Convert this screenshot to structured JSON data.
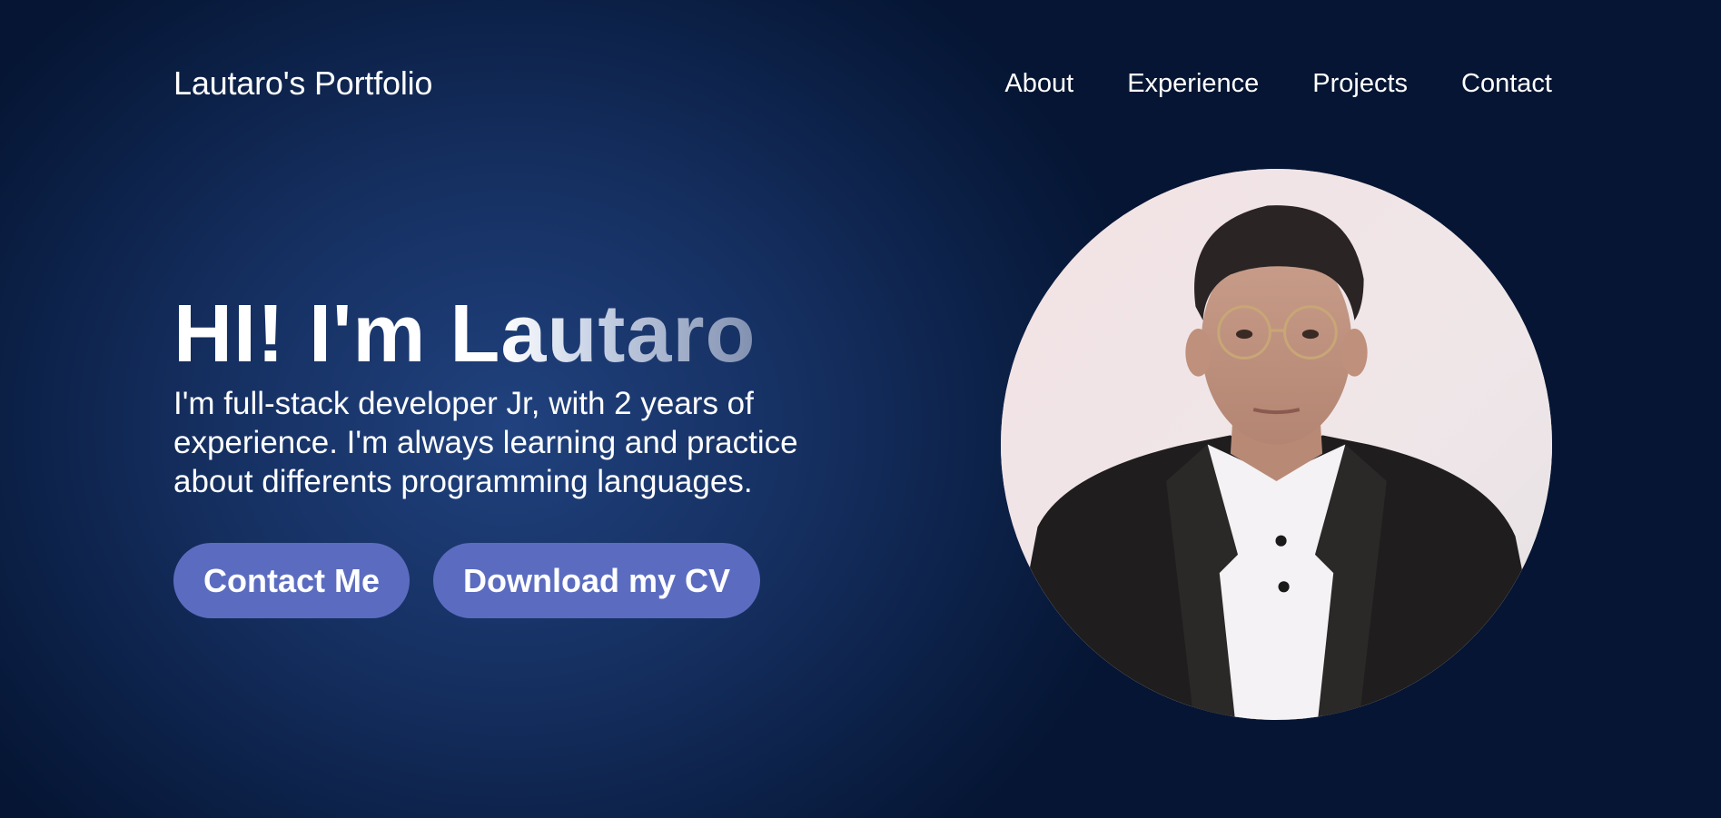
{
  "header": {
    "logo": "Lautaro's Portfolio",
    "nav": [
      {
        "label": "About"
      },
      {
        "label": "Experience"
      },
      {
        "label": "Projects"
      },
      {
        "label": "Contact"
      }
    ]
  },
  "hero": {
    "title": "HI! I'm Lautaro",
    "description": "I'm full-stack developer Jr, with 2 years of experience. I'm always learning and practice about differents programming languages.",
    "buttons": {
      "contact_label": "Contact Me",
      "cv_label": "Download my CV"
    }
  },
  "colors": {
    "background_dark": "#051533",
    "background_light": "#1d3b75",
    "button": "#5b6cc0",
    "text": "#ffffff"
  }
}
